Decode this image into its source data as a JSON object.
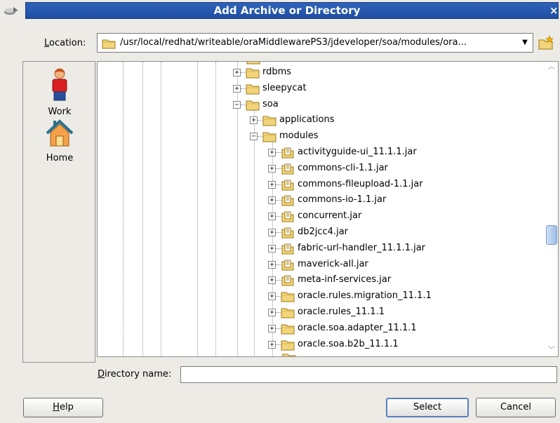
{
  "window": {
    "title": "Add Archive or Directory"
  },
  "location": {
    "label_mnemonic": "L",
    "label_rest": "ocation:",
    "path": "/usr/local/redhat/writeable/oraMiddlewarePS3/jdeveloper/soa/modules/ora..."
  },
  "shortcuts": [
    {
      "label": "Work",
      "icon": "work-user-icon"
    },
    {
      "label": "Home",
      "icon": "home-icon"
    }
  ],
  "tree": {
    "rows": [
      {
        "label": "rdbms",
        "icon": "folder-icon",
        "expanded": false
      },
      {
        "label": "sleepycat",
        "icon": "folder-icon",
        "expanded": false
      },
      {
        "label": "soa",
        "icon": "folder-icon",
        "expanded": true
      },
      {
        "label": "applications",
        "icon": "folder-icon",
        "expanded": false
      },
      {
        "label": "modules",
        "icon": "folder-icon",
        "expanded": true
      },
      {
        "label": "activityguide-ui_11.1.1.jar",
        "icon": "jar-icon",
        "expanded": false
      },
      {
        "label": "commons-cli-1.1.jar",
        "icon": "jar-icon",
        "expanded": false
      },
      {
        "label": "commons-fileupload-1.1.jar",
        "icon": "jar-icon",
        "expanded": false
      },
      {
        "label": "commons-io-1.1.jar",
        "icon": "jar-icon",
        "expanded": false
      },
      {
        "label": "concurrent.jar",
        "icon": "jar-icon",
        "expanded": false
      },
      {
        "label": "db2jcc4.jar",
        "icon": "jar-icon",
        "expanded": false
      },
      {
        "label": "fabric-url-handler_11.1.1.jar",
        "icon": "jar-icon",
        "expanded": false
      },
      {
        "label": "maverick-all.jar",
        "icon": "jar-icon",
        "expanded": false
      },
      {
        "label": "meta-inf-services.jar",
        "icon": "jar-icon",
        "expanded": false
      },
      {
        "label": "oracle.rules.migration_11.1.1",
        "icon": "folder-icon",
        "expanded": false
      },
      {
        "label": "oracle.rules_11.1.1",
        "icon": "folder-icon",
        "expanded": false
      },
      {
        "label": "oracle.soa.adapter_11.1.1",
        "icon": "folder-icon",
        "expanded": false
      },
      {
        "label": "oracle.soa.b2b_11.1.1",
        "icon": "folder-icon",
        "expanded": false
      }
    ]
  },
  "directory_name": {
    "label_mnemonic": "D",
    "label_rest": "irectory name:",
    "value": ""
  },
  "buttons": {
    "help_mnemonic": "H",
    "help_rest": "elp",
    "select": "Select",
    "cancel": "Cancel"
  },
  "colors": {
    "title_bar": "#2f63b8",
    "dialog_bg": "#ecebe6",
    "folder": "#f2d57a"
  }
}
